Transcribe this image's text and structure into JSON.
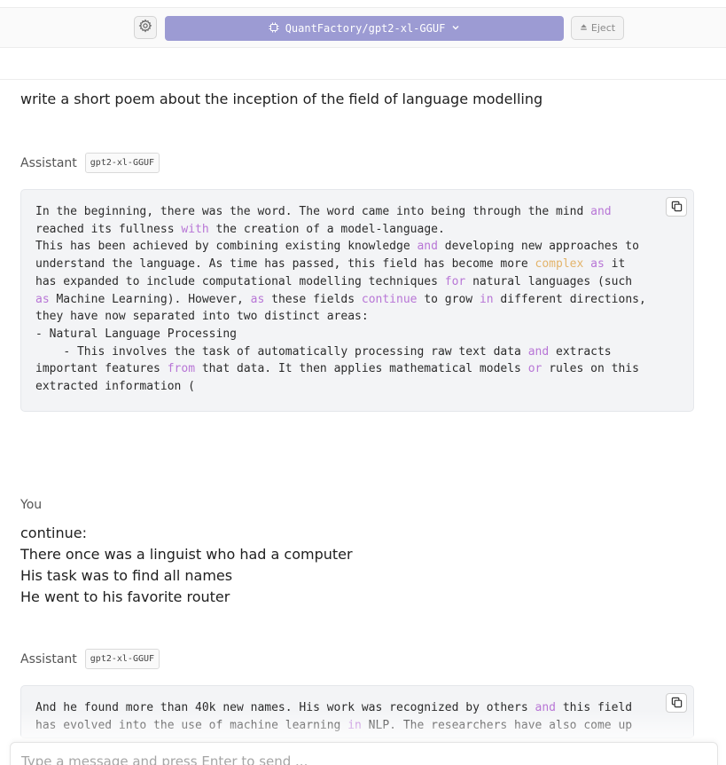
{
  "header": {
    "model_name": "QuantFactory/gpt2-xl-GGUF",
    "eject_label": "Eject"
  },
  "chat": {
    "user_prompt": "write a short poem about the inception of the field of language modelling",
    "assistant_label": "Assistant",
    "model_badge": "gpt2-xl-GGUF",
    "response1": [
      [
        [
          "In the beginning, there was the word. The word came into being through the mind ",
          ""
        ],
        [
          "and",
          "p"
        ]
      ],
      [
        [
          "reached its fullness ",
          ""
        ],
        [
          "with",
          "p"
        ],
        [
          " the creation of a model-language.",
          ""
        ]
      ],
      [
        [
          "This has been achieved by combining existing knowledge ",
          ""
        ],
        [
          "and",
          "p"
        ],
        [
          " developing new approaches to",
          ""
        ]
      ],
      [
        [
          "understand the language. As time has passed, this field has become more ",
          ""
        ],
        [
          "complex",
          "o"
        ],
        [
          " ",
          ""
        ],
        [
          "as",
          "p"
        ],
        [
          " it",
          ""
        ]
      ],
      [
        [
          "has expanded to include computational modelling techniques ",
          ""
        ],
        [
          "for",
          "p"
        ],
        [
          " natural languages (such",
          ""
        ]
      ],
      [
        [
          "as",
          "p"
        ],
        [
          " Machine Learning). However, ",
          ""
        ],
        [
          "as",
          "p"
        ],
        [
          " these fields ",
          ""
        ],
        [
          "continue",
          "p"
        ],
        [
          " to grow ",
          ""
        ],
        [
          "in",
          "p"
        ],
        [
          " different directions,",
          ""
        ]
      ],
      [
        [
          "they have now separated into two distinct areas:",
          ""
        ]
      ],
      [
        [
          "- Natural Language Processing",
          ""
        ]
      ],
      [
        [
          "    - This involves the task of automatically processing raw text data ",
          ""
        ],
        [
          "and",
          "p"
        ],
        [
          " extracts",
          ""
        ]
      ],
      [
        [
          "important features ",
          ""
        ],
        [
          "from",
          "p"
        ],
        [
          " that data. It then applies mathematical models ",
          ""
        ],
        [
          "or",
          "p"
        ],
        [
          " rules on this",
          ""
        ]
      ],
      [
        [
          "extracted information (",
          ""
        ]
      ]
    ],
    "you_label": "You",
    "user_message": "continue:\nThere once was a linguist who had a computer\nHis task was to find all names\nHe went to his favorite router",
    "response2": [
      [
        [
          "And he found more than 40k new names. His work was recognized by others ",
          ""
        ],
        [
          "and",
          "p"
        ],
        [
          " this field",
          ""
        ]
      ],
      [
        [
          "has evolved into the use of machine learning ",
          ""
        ],
        [
          "in",
          "p"
        ],
        [
          " NLP. The researchers have also come up",
          ""
        ]
      ]
    ]
  },
  "composer": {
    "placeholder": "Type a message and press Enter to send ..."
  },
  "colors": {
    "model_pill": "#9c9bd3",
    "keyword_purple": "#b876d6",
    "keyword_orange": "#e3b46b",
    "code_bg": "#f3f4f6"
  },
  "icons": {
    "settings": "gear-icon",
    "model": "chip-icon",
    "dropdown": "chevron-down-icon",
    "eject": "eject-icon",
    "copy": "copy-icon"
  }
}
